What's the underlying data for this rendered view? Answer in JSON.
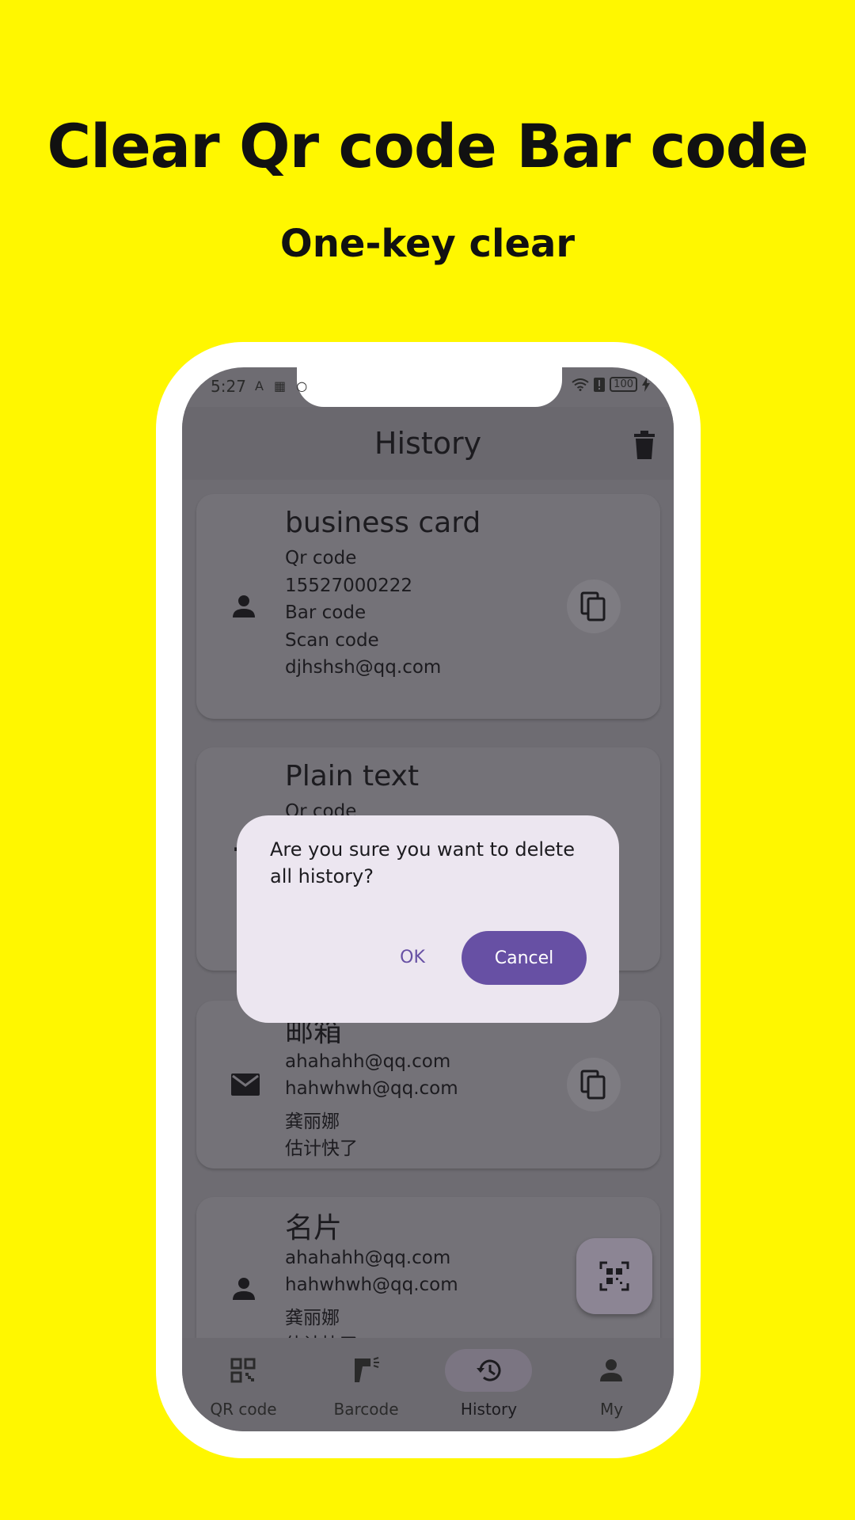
{
  "promo": {
    "headline": "Clear Qr code Bar code",
    "subline": "One-key clear"
  },
  "status_bar": {
    "time": "5:27",
    "left_icons": "A ▦ ○",
    "battery": "100"
  },
  "appbar": {
    "title": "History",
    "action_icon": "trash-icon"
  },
  "cards": [
    {
      "icon": "person-icon",
      "title": " business card",
      "lines": [
        "Qr code",
        "15527000222",
        "Bar code",
        "Scan code",
        "djhshsh@qq.com"
      ]
    },
    {
      "icon": "text-icon",
      "title": "Plain text",
      "lines": [
        "Qr code"
      ]
    },
    {
      "icon": "mail-icon",
      "title": "邮箱",
      "lines": [
        "ahahahh@qq.com",
        "hahwhwh@qq.com",
        "龚丽娜",
        "估计快了"
      ]
    },
    {
      "icon": "person-icon",
      "title": "名片",
      "lines": [
        "ahahahh@qq.com",
        "hahwhwh@qq.com",
        "龚丽娜",
        "估计快了"
      ]
    }
  ],
  "dialog": {
    "message": "Are you sure you want to delete all history?",
    "ok_label": "OK",
    "cancel_label": "Cancel"
  },
  "bottom_nav": {
    "items": [
      {
        "label": "QR code",
        "icon": "qr-grid-icon"
      },
      {
        "label": "Barcode",
        "icon": "scanner-icon"
      },
      {
        "label": "History",
        "icon": "history-icon",
        "active": true
      },
      {
        "label": "My",
        "icon": "person-icon"
      }
    ]
  },
  "colors": {
    "background": "#FFF700",
    "accent": "#6750A4",
    "dialog": "#ECE6F0"
  }
}
